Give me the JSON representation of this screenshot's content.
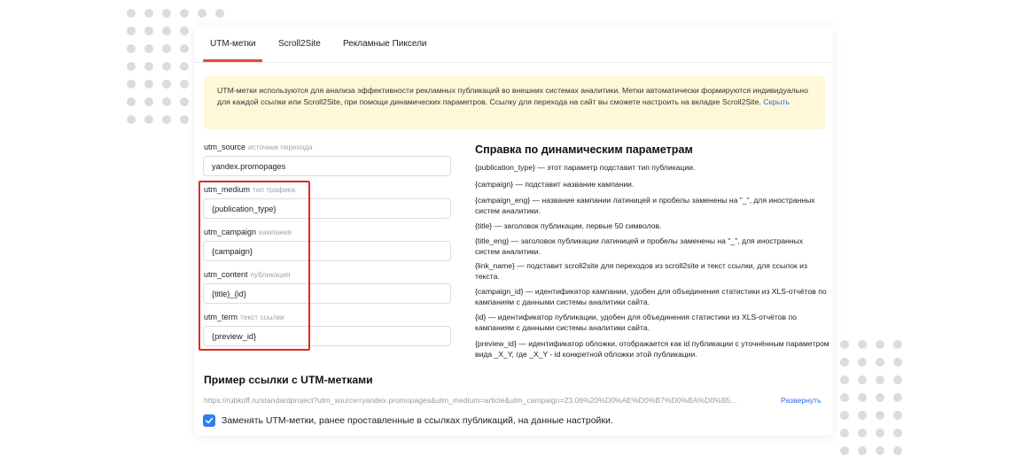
{
  "tabs": [
    {
      "label": "UTM-метки",
      "active": true
    },
    {
      "label": "Scroll2Site",
      "active": false
    },
    {
      "label": "Рекламные Пиксели",
      "active": false
    }
  ],
  "notice": {
    "text": "UTM-метки используются для анализа эффективности рекламных публикаций во внешних системах аналитики. Метки автоматически формируются индивидуально для каждой ссылки или Scroll2Site, при помощи динамических параметров. Ссылку для перехода на сайт вы сможете настроить на вкладке Scroll2Site.",
    "hide_link": "Скрыть"
  },
  "fields": [
    {
      "label": "utm_source",
      "hint": "источник перехода",
      "value": "yandex.promopages"
    },
    {
      "label": "utm_medium",
      "hint": "тип трафика",
      "value": "{publication_type}"
    },
    {
      "label": "utm_campaign",
      "hint": "кампания",
      "value": "{campaign}"
    },
    {
      "label": "utm_content",
      "hint": "публикация",
      "value": "{title}_{id}"
    },
    {
      "label": "utm_term",
      "hint": "текст ссылки",
      "value": "{preview_id}"
    }
  ],
  "help": {
    "title": "Справка по динамическим параметрам",
    "items": [
      "{publication_type} — этот параметр подставит тип публикации.",
      "{campaign} — подставит название кампании.",
      "{campaign_eng} — название кампании латиницей и пробелы заменены на \"_\", для иностранных систем аналитики.",
      "{title} — заголовок публикации, первые 50 символов.",
      "{title_eng} — заголовок публикации латиницей и пробелы заменены на \"_\", для иностранных систем аналитики.",
      "{link_name} — подставит scroll2site для переходов из scroll2site и текст ссылки, для ссылок из текста.",
      "{campaign_id} — идентификатор кампании, удобен для объединения статистики из XLS-отчётов по кампаниям с данными системы аналитики сайта.",
      "{id} — идентификатор публикации, удобен для объединения статистики из XLS-отчётов по кампаниям с данными системы аналитики сайта.",
      "{preview_id} — идентификатор обложки, отображается как id публикации с уточнённым параметром вида _X_Y, где _X_Y - id конкретной обложки этой публикации."
    ]
  },
  "example": {
    "title": "Пример ссылки с UTM-метками",
    "url": "https://rubkoff.ru/standardproject?utm_source=yandex.promopages&utm_medium=article&utm_campaign=23.06%20%D0%AE%D0%B7%D0%BA%D0%B5...",
    "expand_link": "Развернуть"
  },
  "checkbox": {
    "checked": true,
    "label": "Заменять UTM-метки, ранее проставленные в ссылках публикаций, на данные настройки."
  },
  "colors": {
    "accent_blue": "#2f80ed",
    "tab_active_underline": "#e34a3b",
    "notice_background": "#fef7d8",
    "highlight_box": "#e22a1f",
    "link": "#2a6fdb"
  },
  "icons": {
    "checkbox": "checkmark-icon"
  }
}
